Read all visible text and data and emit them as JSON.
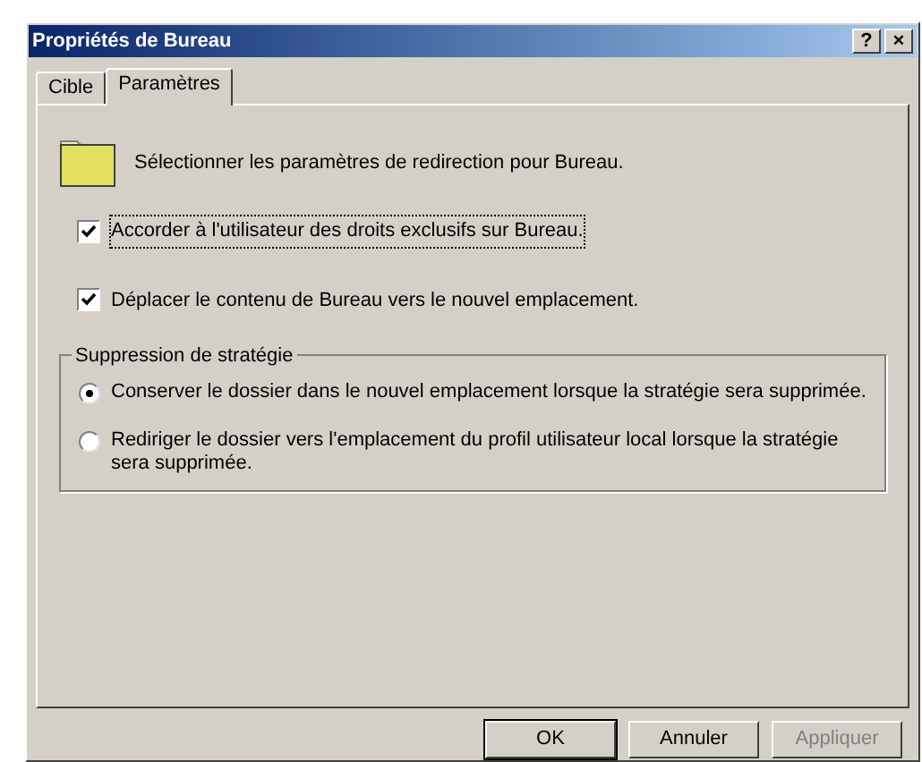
{
  "window": {
    "title": "Propriétés de Bureau",
    "title_buttons": [
      "?",
      "×"
    ]
  },
  "tabs": [
    {
      "label": "Cible",
      "selected": false
    },
    {
      "label": "Paramètres",
      "selected": true
    }
  ],
  "intro": "Sélectionner les paramètres de redirection pour Bureau.",
  "checkboxes": [
    {
      "label": "Accorder à l'utilisateur des droits exclusifs sur Bureau.",
      "checked": true,
      "focused": true
    },
    {
      "label": "Déplacer le contenu de Bureau vers le nouvel emplacement.",
      "checked": true,
      "focused": false
    }
  ],
  "group": {
    "title": "Suppression de stratégie",
    "options": [
      {
        "label": "Conserver le dossier dans le nouvel emplacement lorsque la stratégie sera supprimée.",
        "selected": true
      },
      {
        "label": "Rediriger le dossier vers l'emplacement du profil utilisateur local lorsque la stratégie sera supprimée.",
        "selected": false
      }
    ]
  },
  "buttons": [
    {
      "label": "OK",
      "disabled": false,
      "default": true
    },
    {
      "label": "Annuler",
      "disabled": false,
      "default": false
    },
    {
      "label": "Appliquer",
      "disabled": true,
      "default": false
    }
  ]
}
